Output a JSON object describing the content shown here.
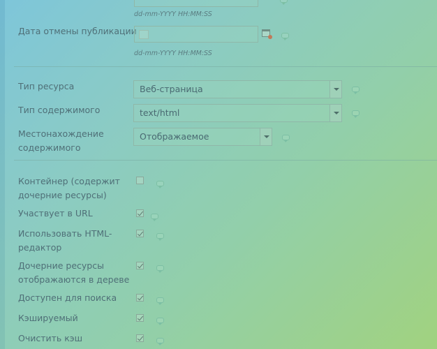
{
  "dates": {
    "format_hint_top": "dd-mm-YYYY HH:MM:SS",
    "unpublish_label": "Дата отмены публикации",
    "unpublish_value": "",
    "format_hint_bottom": "dd-mm-YYYY HH:MM:SS"
  },
  "resource": {
    "type_label": "Тип ресурса",
    "type_value": "Веб-страница",
    "content_type_label": "Тип содержимого",
    "content_type_value": "text/html",
    "location_label": "Местонахождение содержимого",
    "location_value": "Отображаемое"
  },
  "options": [
    {
      "label": "Контейнер (содержит дочерние ресурсы)",
      "checked": false
    },
    {
      "label": "Участвует в URL",
      "checked": true
    },
    {
      "label": "Использовать HTML-редактор",
      "checked": true
    },
    {
      "label": "Дочерние ресурсы отображаются в дереве",
      "checked": true
    },
    {
      "label": "Доступен для поиска",
      "checked": true
    },
    {
      "label": "Кэшируемый",
      "checked": true
    },
    {
      "label": "Очистить кэш",
      "checked": true
    }
  ],
  "icons": {
    "help": "comment-bubble-icon",
    "calendar": "calendar-icon",
    "dropdown": "chevron-down-icon"
  }
}
